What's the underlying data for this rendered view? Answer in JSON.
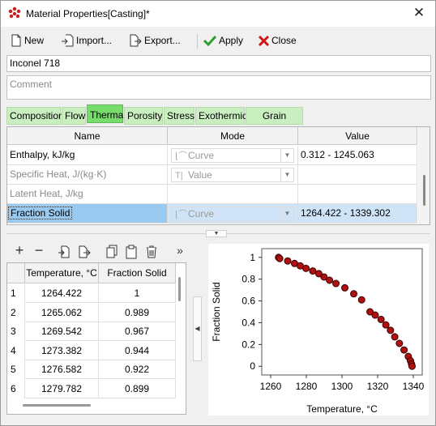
{
  "window": {
    "title": "Material Properties[Casting]*",
    "close_glyph": "✕"
  },
  "toolbar": {
    "new_label": "New",
    "import_label": "Import...",
    "export_label": "Export...",
    "apply_label": "Apply",
    "close_label": "Close"
  },
  "material_name": "Inconel 718",
  "comment_placeholder": "Comment",
  "tabs": [
    {
      "label": "Composition",
      "active": false
    },
    {
      "label": "Flow",
      "active": false
    },
    {
      "label": "Thermal",
      "active": true
    },
    {
      "label": "Porosity",
      "active": false
    },
    {
      "label": "Stress",
      "active": false
    },
    {
      "label": "Exothermic",
      "active": false
    },
    {
      "label": "Grain Growth",
      "active": false
    }
  ],
  "properties_grid": {
    "headers": [
      "Name",
      "Mode",
      "Value"
    ],
    "rows": [
      {
        "name": "Enthalpy, kJ/kg",
        "mode": "Curve",
        "mode_icon": "curve-icon",
        "value": "0.312 - 1245.063",
        "enabled": true
      },
      {
        "name": "Specific Heat, J/(kg·K)",
        "mode": "Value",
        "mode_icon": "value-icon",
        "value": "",
        "enabled": false
      },
      {
        "name": "Latent Heat, J/kg",
        "mode": "",
        "mode_icon": "",
        "value": "",
        "enabled": false
      },
      {
        "name": "Fraction Solid",
        "mode": "Curve",
        "mode_icon": "curve-icon",
        "value": "1264.422 - 1339.302",
        "enabled": true,
        "selected": true
      }
    ]
  },
  "data_toolbar": {
    "icons": [
      "add-row-icon",
      "remove-row-icon",
      "import-data-icon",
      "export-data-icon",
      "copy-icon",
      "paste-icon",
      "delete-icon",
      "more-icon"
    ],
    "more_glyph": "»"
  },
  "data_table": {
    "headers": [
      "",
      "Temperature, °C",
      "Fraction Solid"
    ],
    "rows": [
      [
        "1",
        "1264.422",
        "1"
      ],
      [
        "2",
        "1265.062",
        "0.989"
      ],
      [
        "3",
        "1269.542",
        "0.967"
      ],
      [
        "4",
        "1273.382",
        "0.944"
      ],
      [
        "5",
        "1276.582",
        "0.922"
      ],
      [
        "6",
        "1279.782",
        "0.899"
      ]
    ]
  },
  "colors": {
    "tab_inactive": "#c9efc1",
    "tab_active": "#77dd6a",
    "selection": "#99c9ef",
    "marker_fill": "#b01010",
    "marker_stroke": "#3a0000"
  },
  "chart_data": {
    "type": "scatter",
    "xlabel": "Temperature, °C",
    "ylabel": "Fraction Solid",
    "xlim": [
      1255,
      1345
    ],
    "ylim": [
      -0.08,
      1.08
    ],
    "xticks": [
      1260,
      1280,
      1300,
      1320,
      1340
    ],
    "yticks": [
      0,
      0.2,
      0.4,
      0.6,
      0.8,
      1
    ],
    "grid": false,
    "x": [
      1264.422,
      1265.062,
      1269.542,
      1273.382,
      1276.582,
      1279.782,
      1283.6,
      1287.0,
      1289.9,
      1293.0,
      1296.6,
      1301.6,
      1306.6,
      1311.0,
      1315.7,
      1318.6,
      1321.9,
      1324.6,
      1327.2,
      1329.6,
      1332.2,
      1334.8,
      1337.2,
      1338.4,
      1339.0,
      1339.302
    ],
    "y": [
      1,
      0.989,
      0.967,
      0.944,
      0.922,
      0.899,
      0.875,
      0.85,
      0.82,
      0.79,
      0.76,
      0.72,
      0.665,
      0.61,
      0.5,
      0.47,
      0.43,
      0.38,
      0.33,
      0.27,
      0.21,
      0.15,
      0.09,
      0.05,
      0.02,
      0
    ]
  }
}
